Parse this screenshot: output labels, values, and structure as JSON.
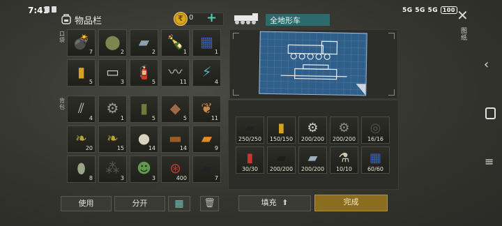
{
  "status_bar": {
    "time": "7:41",
    "network": "5G 5G 5G",
    "battery": "100"
  },
  "inventory": {
    "title": "物品栏",
    "coins": "0",
    "coin_symbol": "₹",
    "section_quick": "口袋",
    "section_backpack": "背包",
    "quick_items": [
      {
        "name": "grenade-icon",
        "glyph": "💣",
        "count": "7",
        "color": "#6a7d3a"
      },
      {
        "name": "landmine-icon",
        "glyph": "⬤",
        "count": "2",
        "color": "#7c8650"
      },
      {
        "name": "glass-sheet-icon",
        "glyph": "▰",
        "count": "2",
        "color": "#8aa0b0"
      },
      {
        "name": "bottle-icon",
        "glyph": "🍾",
        "count": "1",
        "color": "#a0332b"
      },
      {
        "name": "circuit-board-icon",
        "glyph": "▦",
        "count": "1",
        "color": "#3a5fb0"
      },
      {
        "name": "battery-icon",
        "glyph": "▮",
        "count": "5",
        "color": "#d7a21e"
      },
      {
        "name": "cigarettes-icon",
        "glyph": "▭",
        "count": "3",
        "color": "#d8d0bc"
      },
      {
        "name": "fire-extinguisher-icon",
        "glyph": "🧯",
        "count": "5",
        "color": "#c33"
      },
      {
        "name": "spring-icon",
        "glyph": "〰",
        "count": "11",
        "color": "#b5b5b5"
      },
      {
        "name": "electronics-icon",
        "glyph": "⚡",
        "count": "4",
        "color": "#5ab"
      }
    ],
    "backpack_items": [
      {
        "name": "metal-rods-icon",
        "glyph": "⫽",
        "count": "4",
        "color": "#c8c8c8"
      },
      {
        "name": "gear-icon",
        "glyph": "⚙",
        "count": "1",
        "color": "#9a9a9a"
      },
      {
        "name": "jerrycan-icon",
        "glyph": "▮",
        "count": "5",
        "color": "#6f7a3c"
      },
      {
        "name": "leather-icon",
        "glyph": "◆",
        "count": "5",
        "color": "#9c6a44"
      },
      {
        "name": "seeds-icon",
        "glyph": "❦",
        "count": "11",
        "color": "#c78a4a"
      },
      {
        "name": "plant-fiber-icon",
        "glyph": "❧",
        "count": "20",
        "color": "#b8a23a"
      },
      {
        "name": "plant-fiber-icon-2",
        "glyph": "❧",
        "count": "15",
        "color": "#b8a23a"
      },
      {
        "name": "stone-icon",
        "glyph": "●",
        "count": "14",
        "color": "#d9d2c0"
      },
      {
        "name": "wood-log-icon",
        "glyph": "▬",
        "count": "14",
        "color": "#9b5a2a"
      },
      {
        "name": "usb-stick-icon",
        "glyph": "▰",
        "count": "9",
        "color": "#e08a2a"
      },
      {
        "name": "chemical-jar-icon",
        "glyph": "⬮",
        "count": "8",
        "color": "#9aa58a"
      },
      {
        "name": "gravel-icon",
        "glyph": "⁂",
        "count": "3",
        "color": "#555"
      },
      {
        "name": "zombie-doll-icon",
        "glyph": "☻",
        "count": "3",
        "color": "#5f9a4a"
      },
      {
        "name": "bottle-cap-icon",
        "glyph": "⊛",
        "count": "400",
        "color": "#c33"
      },
      {
        "name": "rubber-sheet-icon",
        "glyph": "▰",
        "count": "7",
        "color": "#222"
      }
    ]
  },
  "vehicle": {
    "name": "全地形车",
    "side_label": "图纸",
    "close": "✕"
  },
  "crafting_slots": [
    {
      "name": "rubber-tire-icon",
      "glyph": "▰",
      "count": "250/250",
      "color": "#222"
    },
    {
      "name": "battery-cell-icon",
      "glyph": "▮",
      "count": "150/150",
      "color": "#d7a21e"
    },
    {
      "name": "engine-part-icon",
      "glyph": "⚙",
      "count": "200/200",
      "color": "#cfcfcf"
    },
    {
      "name": "gear-part-icon",
      "glyph": "⚙",
      "count": "200/200",
      "color": "#8c8c8c"
    },
    {
      "name": "tire-icon",
      "glyph": "◎",
      "count": "16/16",
      "color": "#555"
    },
    {
      "name": "gas-canister-icon",
      "glyph": "▮",
      "count": "30/30",
      "color": "#c33"
    },
    {
      "name": "rubber-plate-icon",
      "glyph": "▰",
      "count": "200/200",
      "color": "#1e1e1e"
    },
    {
      "name": "metal-plate-icon",
      "glyph": "▰",
      "count": "200/200",
      "color": "#9bb0bc"
    },
    {
      "name": "spark-plug-icon",
      "glyph": "⚗",
      "count": "10/10",
      "color": "#cfc7b0"
    },
    {
      "name": "circuit-icon",
      "glyph": "▦",
      "count": "60/60",
      "color": "#3a5fb0"
    }
  ],
  "buttons": {
    "use": "使用",
    "split": "分开",
    "grid_view": "▦",
    "trash": "🗑",
    "fill": "填充",
    "done": "完成"
  },
  "nav": {
    "back": "‹",
    "menu": "≡"
  }
}
